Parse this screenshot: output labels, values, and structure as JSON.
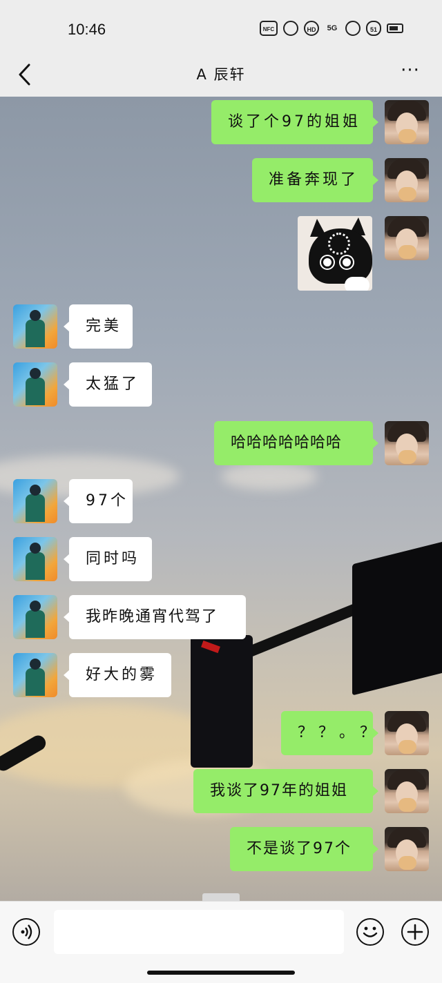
{
  "status_bar": {
    "time": "10:46",
    "icons": [
      "nfc-icon",
      "app-icon",
      "hd-icon",
      "signal-5g-icon",
      "notification-icon",
      "badge-51-icon",
      "battery-icon"
    ],
    "nfc_label": "NFC",
    "hd_label": "HD",
    "network_label": "5G",
    "badge_count": "51"
  },
  "header": {
    "title": "A 辰轩",
    "back_icon": "chevron-left-icon",
    "more_icon": "more-dots-icon",
    "more_glyph": "···"
  },
  "messages": [
    {
      "sender": "me",
      "type": "text",
      "text": "谈了个97的姐姐"
    },
    {
      "sender": "me",
      "type": "text",
      "text": "准备奔现了"
    },
    {
      "sender": "me",
      "type": "sticker",
      "sticker": "black-cat-loading-sticker"
    },
    {
      "sender": "contact",
      "type": "text",
      "text": "完美"
    },
    {
      "sender": "contact",
      "type": "text",
      "text": "太猛了"
    },
    {
      "sender": "me",
      "type": "text",
      "text": "哈哈哈哈哈哈哈"
    },
    {
      "sender": "contact",
      "type": "text",
      "text": "97个"
    },
    {
      "sender": "contact",
      "type": "text",
      "text": "同时吗"
    },
    {
      "sender": "contact",
      "type": "text",
      "text": "我昨晚通宵代驾了"
    },
    {
      "sender": "contact",
      "type": "text",
      "text": "好大的雾"
    },
    {
      "sender": "me",
      "type": "text",
      "text": "？？。？"
    },
    {
      "sender": "me",
      "type": "text",
      "text": "我谈了97年的姐姐"
    },
    {
      "sender": "me",
      "type": "text",
      "text": "不是谈了97个"
    }
  ],
  "input_bar": {
    "voice_icon": "voice-icon",
    "emoji_icon": "emoji-icon",
    "plus_icon": "plus-icon",
    "input_value": "",
    "emoji_glyph": "☺",
    "plus_glyph": "+",
    "voice_glyph": "⦿"
  },
  "colors": {
    "header_bg": "#ededed",
    "outgoing_bubble": "#95ec69",
    "incoming_bubble": "#ffffff"
  }
}
